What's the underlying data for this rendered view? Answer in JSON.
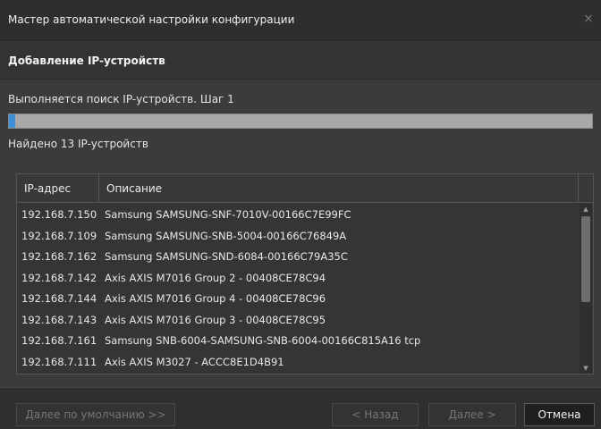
{
  "window": {
    "title": "Мастер автоматической настройки конфигурации",
    "close_symbol": "×"
  },
  "section": {
    "heading": "Добавление IP-устройств"
  },
  "status": {
    "text": "Выполняется поиск IP-устройств. Шаг 1",
    "progress_fraction": 0.01,
    "progress_color": "#3d8fd8"
  },
  "found": {
    "text": "Найдено 13 IP-устройств"
  },
  "table": {
    "columns": [
      "IP-адрес",
      "Описание"
    ],
    "rows": [
      {
        "ip": "192.168.7.150",
        "desc": "Samsung SAMSUNG-SNF-7010V-00166C7E99FC"
      },
      {
        "ip": "192.168.7.109",
        "desc": "Samsung SAMSUNG-SNB-5004-00166C76849A"
      },
      {
        "ip": "192.168.7.162",
        "desc": "Samsung SAMSUNG-SND-6084-00166C79A35C"
      },
      {
        "ip": "192.168.7.142",
        "desc": "Axis AXIS M7016 Group 2 - 00408CE78C94"
      },
      {
        "ip": "192.168.7.144",
        "desc": "Axis AXIS M7016 Group 4 - 00408CE78C96"
      },
      {
        "ip": "192.168.7.143",
        "desc": "Axis AXIS M7016 Group 3 - 00408CE78C95"
      },
      {
        "ip": "192.168.7.161",
        "desc": "Samsung SNB-6004-SAMSUNG-SNB-6004-00166C815A16 tcp"
      },
      {
        "ip": "192.168.7.111",
        "desc": "Axis AXIS M3027 - ACCC8E1D4B91"
      }
    ]
  },
  "footer": {
    "default_label": "Далее по умолчанию >>",
    "back_label": "< Назад",
    "next_label": "Далее >",
    "cancel_label": "Отмена"
  }
}
